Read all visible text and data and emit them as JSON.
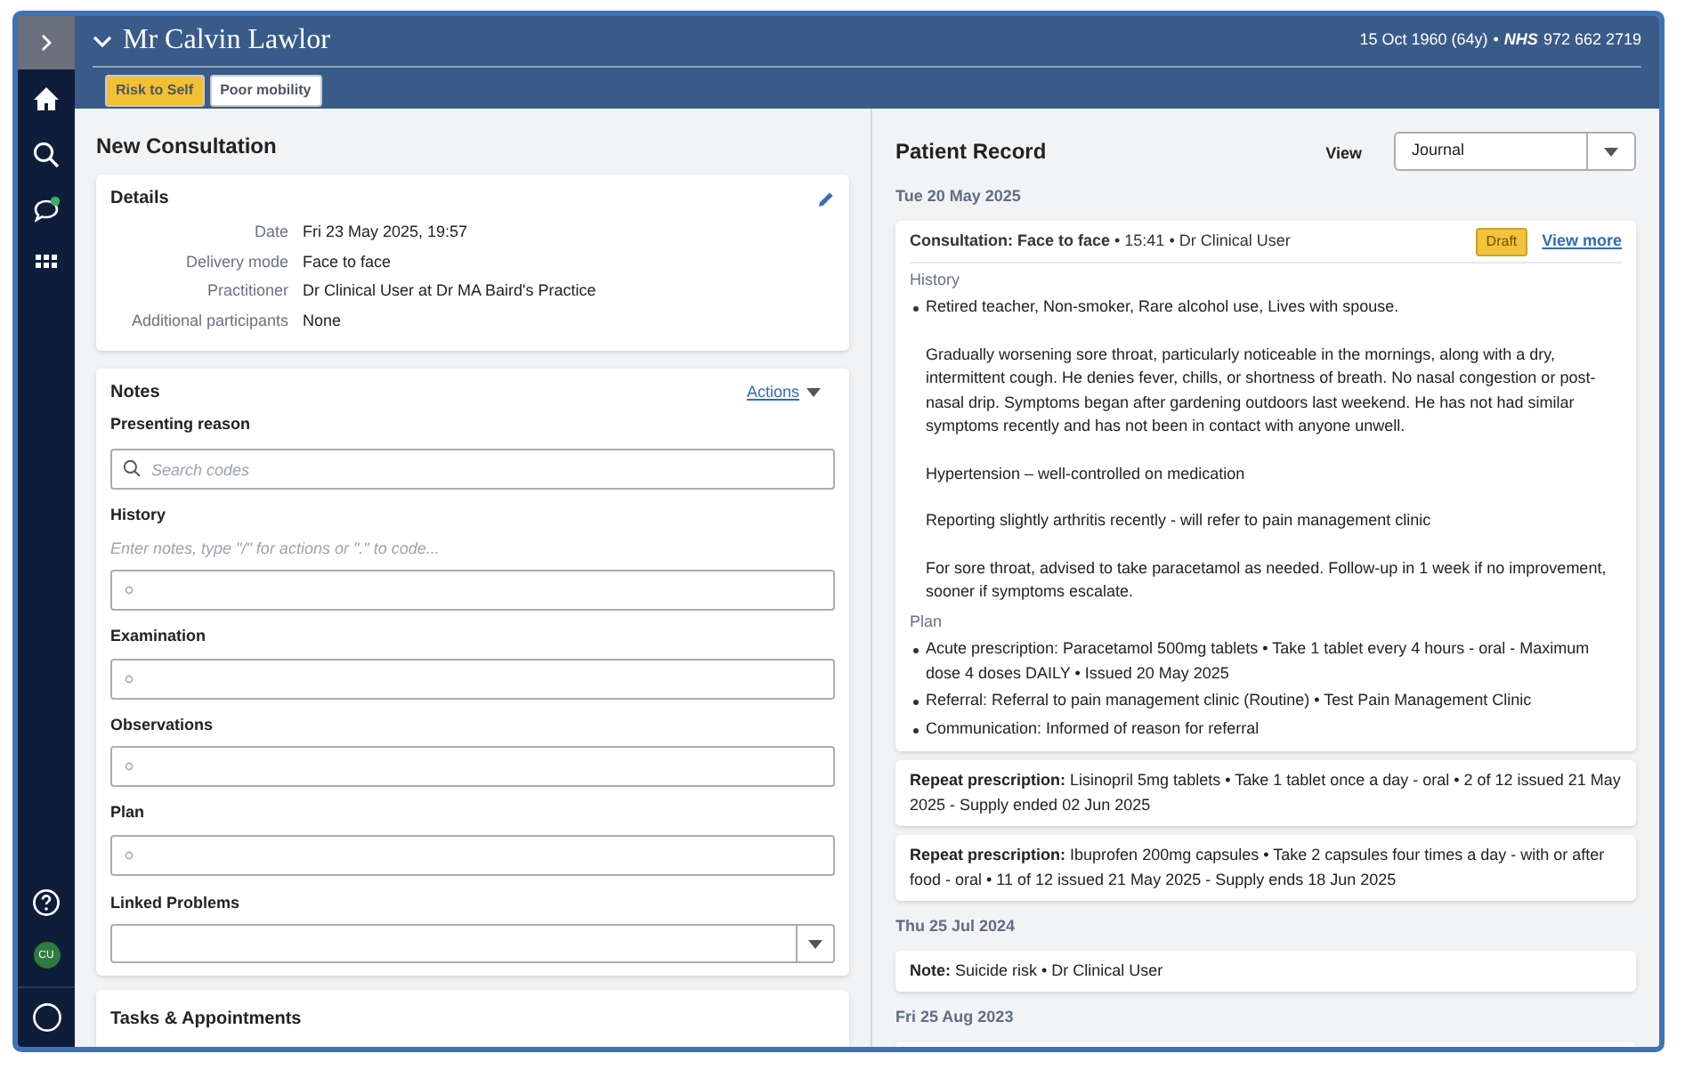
{
  "user": {
    "initials": "CU"
  },
  "header": {
    "patient_name": "Mr Calvin Lawlor",
    "dob": "15 Oct 1960 (64y)",
    "separator": "•",
    "nhs_label": "NHS",
    "nhs_number": "972 662 2719",
    "flags": [
      {
        "label": "Risk to Self",
        "color": "#f2c033"
      },
      {
        "label": "Poor mobility",
        "color": "#ffffff"
      }
    ]
  },
  "consultation": {
    "title": "New Consultation",
    "details": {
      "title": "Details",
      "rows": [
        {
          "label": "Date",
          "value": "Fri 23 May 2025, 19:57"
        },
        {
          "label": "Delivery mode",
          "value": "Face to face"
        },
        {
          "label": "Practitioner",
          "value": "Dr Clinical User at Dr MA Baird's Practice"
        },
        {
          "label": "Additional participants",
          "value": "None"
        }
      ]
    },
    "notes": {
      "title": "Notes",
      "actions": "Actions",
      "presenting_reason": {
        "label": "Presenting reason",
        "placeholder": "Search codes"
      },
      "sections": [
        {
          "label": "History",
          "hint": "Enter notes, type \"/\" for actions or \".\" to code..."
        },
        {
          "label": "Examination"
        },
        {
          "label": "Observations"
        },
        {
          "label": "Plan"
        }
      ],
      "linked_problems": {
        "label": "Linked Problems"
      }
    },
    "tasks": {
      "title": "Tasks & Appointments"
    }
  },
  "record": {
    "title": "Patient Record",
    "view_label": "View",
    "view_value": "Journal",
    "days": [
      {
        "date": "Tue 20 May 2025",
        "entries": [
          {
            "kind": "consultation",
            "heading": "**Consultation: Face to face** • 15:41 • Dr Clinical User",
            "badge": "Draft",
            "link": "View more",
            "sections": [
              {
                "title": "History",
                "items": [
                  {
                    "kind": "bullet",
                    "text": "Retired teacher, Non-smoker, Rare alcohol use, Lives with spouse."
                  },
                  {
                    "kind": "paragraph",
                    "text": "Gradually worsening sore throat, particularly noticeable in the mornings, along with a dry, intermittent cough. He denies fever, chills, or shortness of breath. No nasal congestion or post-nasal drip. Symptoms began after gardening outdoors last weekend. He has not had similar symptoms recently and has not been in contact with anyone unwell."
                  },
                  {
                    "kind": "paragraph",
                    "text": "Hypertension – well-controlled on medication"
                  },
                  {
                    "kind": "paragraph",
                    "text": "Reporting slightly arthritis recently - will refer to pain management clinic"
                  },
                  {
                    "kind": "paragraph",
                    "text": "For sore throat, advised to take paracetamol as needed. Follow-up in 1 week if no improvement, sooner if symptoms escalate."
                  }
                ]
              },
              {
                "title": "Plan",
                "items": [
                  {
                    "kind": "bullet",
                    "text": "Acute prescription: Paracetamol 500mg tablets • Take 1 tablet every 4 hours - oral - Maximum dose 4 doses DAILY • Issued 20 May 2025"
                  },
                  {
                    "kind": "bullet",
                    "text": "Referral: Referral to pain management clinic (Routine) • Test Pain Management Clinic"
                  },
                  {
                    "kind": "bullet",
                    "text": "Communication: Informed of reason for referral"
                  }
                ]
              }
            ]
          },
          {
            "kind": "simple",
            "text": "**Repeat prescription:** Lisinopril 5mg tablets • Take 1 tablet once a day - oral • 2 of 12 issued 21 May 2025 - Supply ended 02 Jun 2025"
          },
          {
            "kind": "simple",
            "text": "**Repeat prescription:** Ibuprofen 200mg capsules • Take 2 capsules four times a day - with or after food - oral • 11 of 12 issued 21 May 2025 - Supply ends 18 Jun 2025"
          }
        ]
      },
      {
        "date": "Thu 25 Jul 2024",
        "entries": [
          {
            "kind": "simple",
            "text": "**Note:** Suicide risk • Dr Clinical User"
          }
        ]
      },
      {
        "date": "Fri 25 Aug 2023",
        "entries": [
          {
            "kind": "cut_off"
          }
        ]
      }
    ]
  }
}
